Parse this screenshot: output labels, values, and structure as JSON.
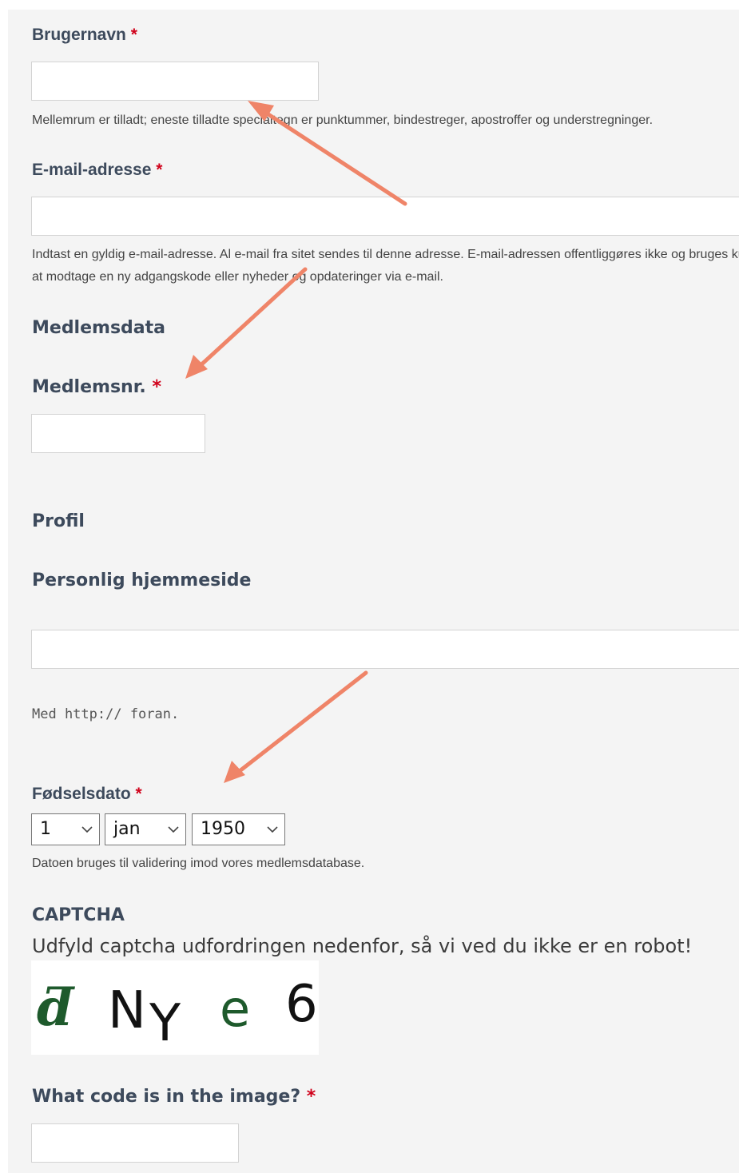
{
  "form": {
    "username": {
      "label": "Brugernavn",
      "required_mark": "*",
      "value": "",
      "help": "Mellemrum er tilladt; eneste tilladte specialtegn er punktummer, bindestreger, apostroffer og understregninger."
    },
    "email": {
      "label": "E-mail-adresse",
      "required_mark": "*",
      "value": "",
      "help_line1": "Indtast en gyldig e-mail-adresse. Al e-mail fra sitet sendes til denne adresse. E-mail-adressen offentliggøres ikke og bruges kun hvis du ønsker",
      "help_line2": "at modtage en ny adgangskode eller nyheder og opdateringer via e-mail."
    },
    "member_section": {
      "title": "Medlemsdata"
    },
    "member_no": {
      "label": "Medlemsnr.",
      "required_mark": "*",
      "value": ""
    },
    "profile_section": {
      "title": "Profil"
    },
    "homepage": {
      "label": "Personlig hjemmeside",
      "value": "",
      "help": "Med http:// foran."
    },
    "birthdate": {
      "label": "Fødselsdato",
      "required_mark": "*",
      "day": "1",
      "month": "jan",
      "year": "1950",
      "help": "Datoen bruges til validering imod vores medlemsdatabase."
    },
    "captcha": {
      "title": "CAPTCHA",
      "instruction": "Udfyld captcha udfordringen nedenfor, så vi ved du ikke er en robot!",
      "image_chars": [
        "ƌ",
        "N",
        "Y",
        "e",
        "6"
      ],
      "question": "What code is in the image?",
      "required_mark": "*",
      "value": ""
    }
  },
  "colors": {
    "panel_bg": "#f4f4f4",
    "required": "#d0021b",
    "label": "#3d4a5c",
    "annotation_arrow": "#ef8468"
  }
}
